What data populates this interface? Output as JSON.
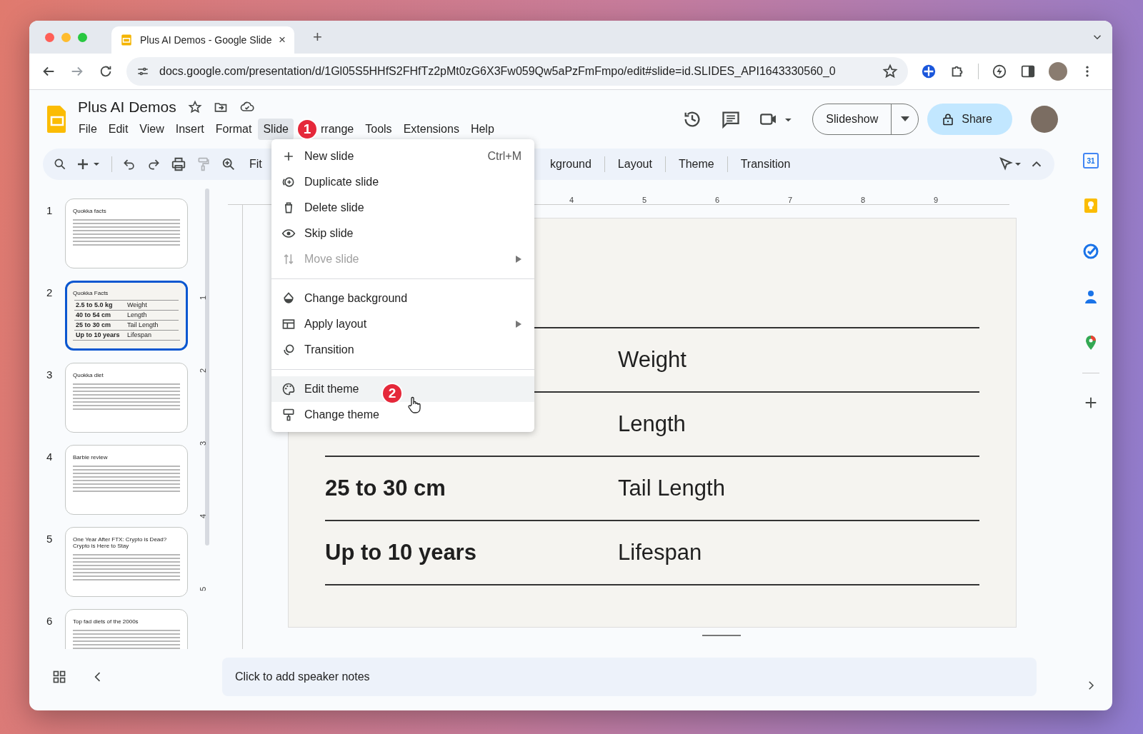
{
  "browser": {
    "tab": {
      "title": "Plus AI Demos - Google Slide",
      "close": "×"
    },
    "new_tab": "+",
    "url": "docs.google.com/presentation/d/1Gl05S5HHfS2FHfTz2pMt0zG6X3Fw059Qw5aPzFmFmpo/edit#slide=id.SLIDES_API1643330560_0"
  },
  "app": {
    "title": "Plus AI Demos",
    "menus": [
      {
        "label": "File",
        "selected": false
      },
      {
        "label": "Edit",
        "selected": false
      },
      {
        "label": "View",
        "selected": false
      },
      {
        "label": "Insert",
        "selected": false
      },
      {
        "label": "Format",
        "selected": false
      },
      {
        "label": "Slide",
        "selected": true
      },
      {
        "label": "rrange",
        "selected": false
      },
      {
        "label": "Tools",
        "selected": false
      },
      {
        "label": "Extensions",
        "selected": false
      },
      {
        "label": "Help",
        "selected": false
      }
    ],
    "slideshow": "Slideshow",
    "share": "Share"
  },
  "toolbar": {
    "zoom": "Fit",
    "buttons": [
      "kground",
      "Layout",
      "Theme",
      "Transition"
    ]
  },
  "slides": [
    {
      "number": "1",
      "title": "Quokka facts",
      "kind": "text",
      "selected": false
    },
    {
      "number": "2",
      "title": "Quokka Facts",
      "kind": "table",
      "selected": true,
      "rows": [
        [
          "2.5 to 5.0 kg",
          "Weight"
        ],
        [
          "40 to 54 cm",
          "Length"
        ],
        [
          "25 to 30 cm",
          "Tail Length"
        ],
        [
          "Up to 10 years",
          "Lifespan"
        ]
      ]
    },
    {
      "number": "3",
      "title": "Quokka diet",
      "kind": "text",
      "selected": false
    },
    {
      "number": "4",
      "title": "Barbie review",
      "kind": "text",
      "selected": false
    },
    {
      "number": "5",
      "title": "One Year After FTX: Crypto is Dead? Crypto is Here to Stay",
      "kind": "text",
      "selected": false
    },
    {
      "number": "6",
      "title": "Top fad diets of the 2000s",
      "kind": "text",
      "selected": false
    }
  ],
  "ruler": {
    "horizontal": [
      "4",
      "5",
      "6",
      "7",
      "8",
      "9"
    ],
    "vertical": [
      "1",
      "2",
      "3",
      "4",
      "5"
    ]
  },
  "slide": {
    "rows": [
      {
        "label": "Weight"
      },
      {
        "label": "Length"
      },
      {
        "value": "25 to 30 cm",
        "label": "Tail Length"
      },
      {
        "value": "Up to 10 years",
        "label": "Lifespan"
      }
    ]
  },
  "menu": {
    "items": [
      {
        "kind": "item",
        "label": "New slide",
        "shortcut": "Ctrl+M",
        "disabled": false,
        "submenu": false,
        "highlighted": false
      },
      {
        "kind": "item",
        "label": "Duplicate slide",
        "disabled": false,
        "submenu": false,
        "highlighted": false
      },
      {
        "kind": "item",
        "label": "Delete slide",
        "disabled": false,
        "submenu": false,
        "highlighted": false
      },
      {
        "kind": "item",
        "label": "Skip slide",
        "disabled": false,
        "submenu": false,
        "highlighted": false
      },
      {
        "kind": "item",
        "label": "Move slide",
        "disabled": true,
        "submenu": true,
        "highlighted": false
      },
      {
        "kind": "divider"
      },
      {
        "kind": "item",
        "label": "Change background",
        "disabled": false,
        "submenu": false,
        "highlighted": false
      },
      {
        "kind": "item",
        "label": "Apply layout",
        "disabled": false,
        "submenu": true,
        "highlighted": false
      },
      {
        "kind": "item",
        "label": "Transition",
        "disabled": false,
        "submenu": false,
        "highlighted": false
      },
      {
        "kind": "divider"
      },
      {
        "kind": "item",
        "label": "Edit theme",
        "disabled": false,
        "submenu": false,
        "highlighted": true
      },
      {
        "kind": "item",
        "label": "Change theme",
        "disabled": false,
        "submenu": false,
        "highlighted": false
      }
    ]
  },
  "badges": [
    "1",
    "2"
  ],
  "side_panel": {
    "calendar_day": "31"
  },
  "notes": {
    "placeholder": "Click to add speaker notes"
  }
}
